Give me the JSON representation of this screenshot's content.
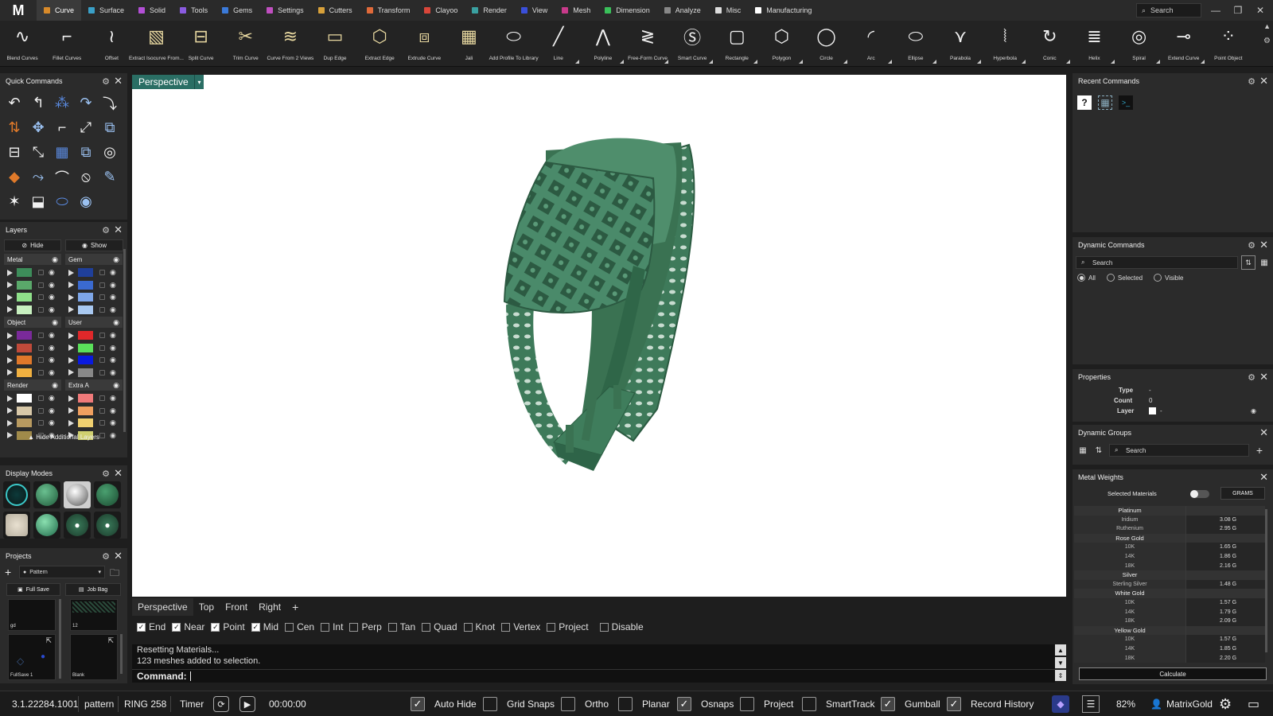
{
  "app": {
    "logo": "M"
  },
  "menu_tabs": [
    {
      "label": "Curve",
      "color": "#d88a2a",
      "active": true
    },
    {
      "label": "Surface",
      "color": "#3aa0c8"
    },
    {
      "label": "Solid",
      "color": "#b34fd6"
    },
    {
      "label": "Tools",
      "color": "#8a5be0"
    },
    {
      "label": "Gems",
      "color": "#3b7ad9"
    },
    {
      "label": "Settings",
      "color": "#c04fc0"
    },
    {
      "label": "Cutters",
      "color": "#d8a13a"
    },
    {
      "label": "Transform",
      "color": "#e06a3a"
    },
    {
      "label": "Clayoo",
      "color": "#d9463a"
    },
    {
      "label": "Render",
      "color": "#3aa0a0"
    },
    {
      "label": "View",
      "color": "#3a4fd9"
    },
    {
      "label": "Mesh",
      "color": "#c83a8a"
    },
    {
      "label": "Dimension",
      "color": "#3ac05a"
    },
    {
      "label": "Analyze",
      "color": "#888888"
    },
    {
      "label": "Misc",
      "color": "#dddddd"
    },
    {
      "label": "Manufacturing",
      "color": "#ffffff"
    }
  ],
  "top_search": "Search",
  "toolbar": [
    "Blend Curves",
    "Fillet Curves",
    "Offset",
    "Extract Isocurve From...",
    "Split Curve",
    "Trim Curve",
    "Curve From 2 Views",
    "Dup Edge",
    "Extract Edge",
    "Extrude Curve",
    "Jali",
    "Add Profile To Library",
    "Line",
    "Polyline",
    "Free-Form Curve",
    "Smart Curve",
    "Rectangle",
    "Polygon",
    "Circle",
    "Arc",
    "Ellipse",
    "Parabola",
    "Hyperbola",
    "Conic",
    "Helix",
    "Spiral",
    "Extend Curve",
    "Point Object"
  ],
  "panels": {
    "quick_commands": "Quick Commands",
    "layers": "Layers",
    "display_modes": "Display Modes",
    "projects": "Projects",
    "recent_commands": "Recent Commands",
    "dynamic_commands": "Dynamic Commands",
    "properties": "Properties",
    "dynamic_groups": "Dynamic Groups",
    "metal_weights": "Metal Weights"
  },
  "layers": {
    "hide_label": "Hide",
    "show_label": "Show",
    "groups": [
      {
        "name": "Metal",
        "colors": [
          "#3d8c5a",
          "#5aa86a",
          "#8fe08a",
          "#c8f0c0"
        ]
      },
      {
        "name": "Gem",
        "colors": [
          "#1f3f9a",
          "#3a6ad0",
          "#7ea6e8",
          "#a8c8f0"
        ]
      },
      {
        "name": "Object",
        "colors": [
          "#7a2a9a",
          "#c04a3a",
          "#e0782a",
          "#f0b040"
        ]
      },
      {
        "name": "User",
        "colors": [
          "#e0282a",
          "#5ae05a",
          "#0a1adf",
          "#888888"
        ]
      },
      {
        "name": "Render",
        "colors": [
          "#ffffff",
          "#d8c8a8",
          "#b89a60",
          "#a08a4a"
        ]
      },
      {
        "name": "Extra A",
        "colors": [
          "#f07a7a",
          "#f0a060",
          "#f0d070",
          "#d0d070"
        ]
      }
    ],
    "hide_additional": "Hide Additional Layers"
  },
  "projects": {
    "selected": "Pattern",
    "full_save": "Full Save",
    "job_bag": "Job Bag",
    "thumbs": [
      "gd",
      "12",
      "FullSave 1",
      "Blank"
    ]
  },
  "viewport": {
    "label": "Perspective",
    "tabs": [
      "Perspective",
      "Top",
      "Front",
      "Right"
    ],
    "add_tab": "+"
  },
  "snaps": [
    {
      "label": "End",
      "on": true
    },
    {
      "label": "Near",
      "on": true
    },
    {
      "label": "Point",
      "on": true
    },
    {
      "label": "Mid",
      "on": true
    },
    {
      "label": "Cen",
      "on": false
    },
    {
      "label": "Int",
      "on": false
    },
    {
      "label": "Perp",
      "on": false
    },
    {
      "label": "Tan",
      "on": false
    },
    {
      "label": "Quad",
      "on": false
    },
    {
      "label": "Knot",
      "on": false
    },
    {
      "label": "Vertex",
      "on": false
    },
    {
      "label": "Project",
      "on": false
    },
    {
      "label": "Disable",
      "on": false
    }
  ],
  "command": {
    "history": [
      "Resetting Materials...",
      "123 meshes added to selection."
    ],
    "prompt": "Command:"
  },
  "status": {
    "version": "3.1.22284.1001",
    "project": "pattern",
    "file": "RING 258",
    "timer_label": "Timer",
    "timer_value": "00:00:00",
    "toggles": [
      {
        "label": "Auto Hide",
        "on": true
      },
      {
        "label": "Grid Snaps",
        "on": false
      },
      {
        "label": "Ortho",
        "on": false
      },
      {
        "label": "Planar",
        "on": false
      },
      {
        "label": "Osnaps",
        "on": true
      },
      {
        "label": "Project",
        "on": false
      },
      {
        "label": "SmartTrack",
        "on": false
      },
      {
        "label": "Gumball",
        "on": true
      },
      {
        "label": "Record History",
        "on": true
      }
    ],
    "zoom": "82%",
    "user": "MatrixGold"
  },
  "dynamic_commands": {
    "search_placeholder": "Search",
    "radios": [
      {
        "label": "All",
        "on": true
      },
      {
        "label": "Selected",
        "on": false
      },
      {
        "label": "Visible",
        "on": false
      }
    ]
  },
  "properties": {
    "type_label": "Type",
    "type_value": "-",
    "count_label": "Count",
    "count_value": "0",
    "layer_label": "Layer",
    "layer_value": "-"
  },
  "dynamic_groups": {
    "search_placeholder": "Search",
    "add": "+"
  },
  "metal_weights": {
    "selected_materials": "Selected Materials",
    "unit": "GRAMS",
    "rows": [
      {
        "kind": "head",
        "name": "Platinum",
        "value": ""
      },
      {
        "kind": "sub",
        "name": "Iridium",
        "value": "3.08 G"
      },
      {
        "kind": "sub",
        "name": "Ruthenium",
        "value": "2.95 G"
      },
      {
        "kind": "head",
        "name": "Rose Gold",
        "value": ""
      },
      {
        "kind": "sub",
        "name": "10K",
        "value": "1.65 G"
      },
      {
        "kind": "sub",
        "name": "14K",
        "value": "1.86 G"
      },
      {
        "kind": "sub",
        "name": "18K",
        "value": "2.16 G"
      },
      {
        "kind": "head",
        "name": "Silver",
        "value": ""
      },
      {
        "kind": "sub",
        "name": "Sterling Silver",
        "value": "1.48 G"
      },
      {
        "kind": "head",
        "name": "White Gold",
        "value": ""
      },
      {
        "kind": "sub",
        "name": "10K",
        "value": "1.57 G"
      },
      {
        "kind": "sub",
        "name": "14K",
        "value": "1.79 G"
      },
      {
        "kind": "sub",
        "name": "18K",
        "value": "2.09 G"
      },
      {
        "kind": "head",
        "name": "Yellow Gold",
        "value": ""
      },
      {
        "kind": "sub",
        "name": "10K",
        "value": "1.57 G"
      },
      {
        "kind": "sub",
        "name": "14K",
        "value": "1.85 G"
      },
      {
        "kind": "sub",
        "name": "18K",
        "value": "2.20 G"
      }
    ],
    "calculate": "Calculate"
  },
  "colors": {
    "accent_teal": "#2a6e64",
    "ring_green": "#3f7d5c"
  }
}
